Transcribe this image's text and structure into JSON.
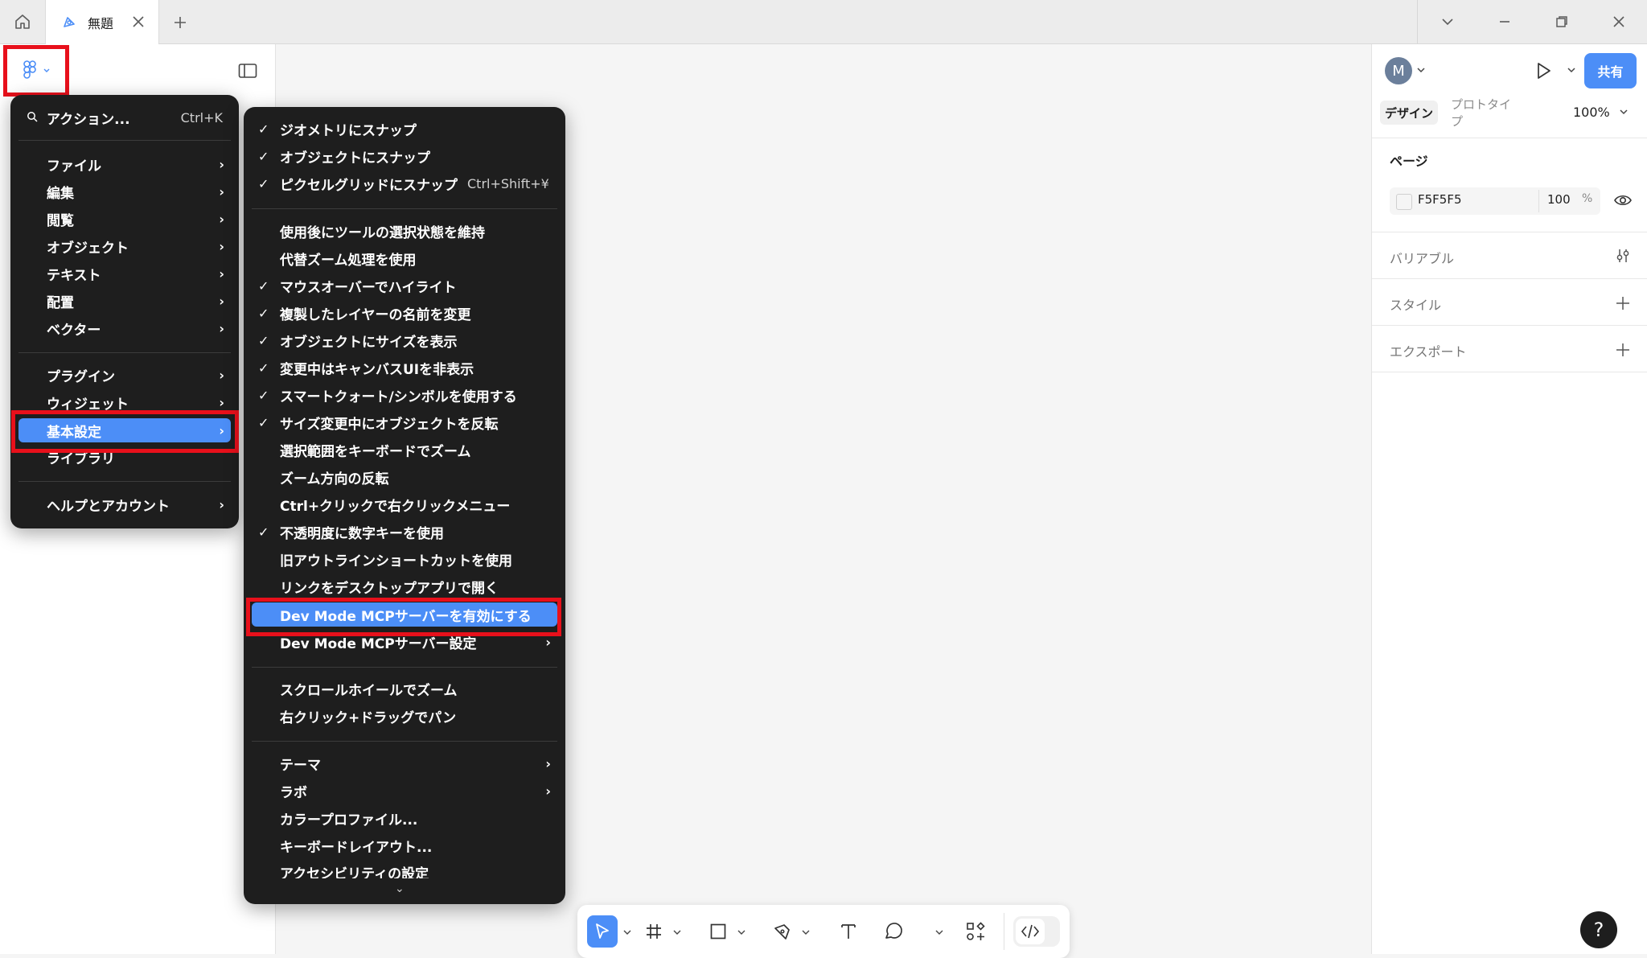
{
  "titlebar": {
    "tab_label": "無題"
  },
  "left_panel": {
    "main_menu": {
      "search_label": "アクション...",
      "search_shortcut": "Ctrl+K",
      "items": [
        {
          "label": "ファイル"
        },
        {
          "label": "編集"
        },
        {
          "label": "閲覧"
        },
        {
          "label": "オブジェクト"
        },
        {
          "label": "テキスト"
        },
        {
          "label": "配置"
        },
        {
          "label": "ベクター"
        },
        {
          "label": "プラグイン"
        },
        {
          "label": "ウィジェット"
        },
        {
          "label": "基本設定",
          "selected": true
        },
        {
          "label": "ライブラリ"
        },
        {
          "label": "ヘルプとアカウント"
        }
      ]
    }
  },
  "preferences_menu": {
    "items": [
      {
        "label": "ジオメトリにスナップ",
        "checked": true
      },
      {
        "label": "オブジェクトにスナップ",
        "checked": true
      },
      {
        "label": "ピクセルグリッドにスナップ",
        "checked": true,
        "shortcut": "Ctrl+Shift+¥"
      },
      {
        "label": "使用後にツールの選択状態を維持",
        "checked": false
      },
      {
        "label": "代替ズーム処理を使用",
        "checked": false
      },
      {
        "label": "マウスオーバーでハイライト",
        "checked": true
      },
      {
        "label": "複製したレイヤーの名前を変更",
        "checked": true
      },
      {
        "label": "オブジェクトにサイズを表示",
        "checked": true
      },
      {
        "label": "変更中はキャンバスUIを非表示",
        "checked": true
      },
      {
        "label": "スマートクォート/シンボルを使用する",
        "checked": true
      },
      {
        "label": "サイズ変更中にオブジェクトを反転",
        "checked": true
      },
      {
        "label": "選択範囲をキーボードでズーム",
        "checked": false
      },
      {
        "label": "ズーム方向の反転",
        "checked": false
      },
      {
        "label": "Ctrl+クリックで右クリックメニュー",
        "checked": false
      },
      {
        "label": "不透明度に数字キーを使用",
        "checked": true
      },
      {
        "label": "旧アウトラインショートカットを使用",
        "checked": false
      },
      {
        "label": "リンクをデスクトップアプリで開く",
        "checked": false
      },
      {
        "label": "Dev Mode MCPサーバーを有効にする",
        "checked": false,
        "selected": true
      },
      {
        "label": "Dev Mode MCPサーバー設定",
        "checked": false
      },
      {
        "label": "スクロールホイールでズーム",
        "checked": false
      },
      {
        "label": "右クリック+ドラッグでパン",
        "checked": false
      },
      {
        "label": "テーマ",
        "checked": false
      },
      {
        "label": "ラボ",
        "checked": false
      },
      {
        "label": "カラープロファイル...",
        "checked": false
      },
      {
        "label": "キーボードレイアウト...",
        "checked": false
      },
      {
        "label": "アクセシビリティの設定",
        "checked": false
      }
    ],
    "check_glyph": "✓",
    "chevron_glyph": "›",
    "more_glyph": "⌄"
  },
  "right_panel": {
    "avatar_initial": "M",
    "share_label": "共有",
    "tabs": {
      "design": "デザイン",
      "prototype": "プロトタイプ"
    },
    "zoom": "100%",
    "page_section": {
      "title": "ページ",
      "background_hex": "F5F5F5",
      "opacity": "100",
      "opacity_unit": "%"
    },
    "variables_label": "バリアブル",
    "styles_label": "スタイル",
    "export_label": "エクスポート"
  },
  "help_label": "?",
  "colors": {
    "accent": "#4c8ef7",
    "menu_bg": "#1e1e1e",
    "highlight_box": "#e8101b"
  }
}
